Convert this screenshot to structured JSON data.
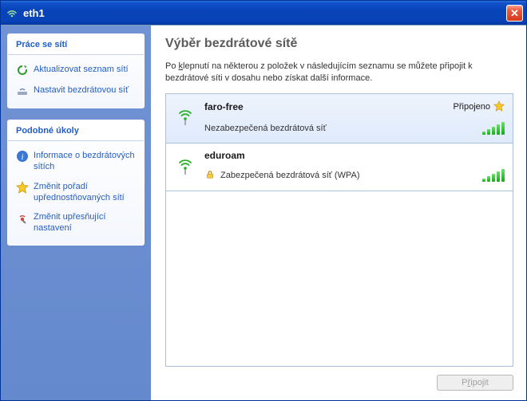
{
  "titlebar": {
    "title": "eth1",
    "close_glyph": "✕"
  },
  "sidebar": {
    "panel1": {
      "header": "Práce se sítí",
      "items": [
        {
          "label": "Aktualizovat seznam sítí",
          "icon": "refresh-icon"
        },
        {
          "label": "Nastavit bezdrátovou síť",
          "icon": "setup-wireless-icon"
        }
      ]
    },
    "panel2": {
      "header": "Podobné úkoly",
      "items": [
        {
          "label": "Informace o bezdrátových sítích",
          "icon": "info-icon"
        },
        {
          "label": "Změnit pořadí upřednostňovaných sítí",
          "icon": "favorite-icon"
        },
        {
          "label": "Změnit upřesňující nastavení",
          "icon": "advanced-settings-icon"
        }
      ]
    }
  },
  "content": {
    "heading": "Výběr bezdrátové sítě",
    "description_pre": "Po ",
    "description_mnemonic": "k",
    "description_post": "lepnutí na některou z položek v následujícím seznamu se můžete připojit k bezdrátové síti v dosahu nebo získat další informace.",
    "connect_button_prefix": "P",
    "connect_button_mnemonic": "ř",
    "connect_button_suffix": "ipojit"
  },
  "networks": [
    {
      "name": "faro-free",
      "status": "Připojeno",
      "starred": true,
      "security": "Nezabezpečená bezdrátová síť",
      "secured": false,
      "selected": true
    },
    {
      "name": "eduroam",
      "status": "",
      "starred": false,
      "security": "Zabezpečená bezdrátová síť (WPA)",
      "secured": true,
      "selected": false
    }
  ]
}
